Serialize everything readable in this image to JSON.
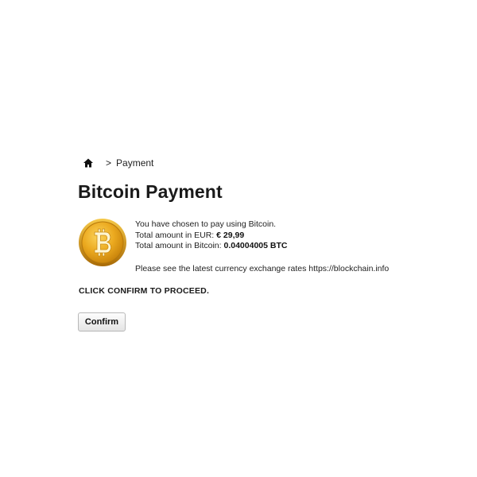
{
  "breadcrumb": {
    "home_icon": "home-icon",
    "separator": ">",
    "current": "Payment"
  },
  "page": {
    "title": "Bitcoin Payment"
  },
  "payment": {
    "coin_icon": "bitcoin-coin-icon",
    "intro": "You have chosen to pay using Bitcoin.",
    "eur_label": "Total amount in EUR: ",
    "eur_value": "€ 29,99",
    "btc_label": "Total amount in Bitcoin: ",
    "btc_value": "0.04004005 BTC",
    "rates_text": "Please see the latest currency exchange rates https://blockchain.info"
  },
  "instruction": "CLICK CONFIRM TO PROCEED.",
  "actions": {
    "confirm_label": "Confirm"
  },
  "colors": {
    "coin_gold": "#e9a51c",
    "coin_dark": "#b97a0b",
    "text": "#222222"
  }
}
